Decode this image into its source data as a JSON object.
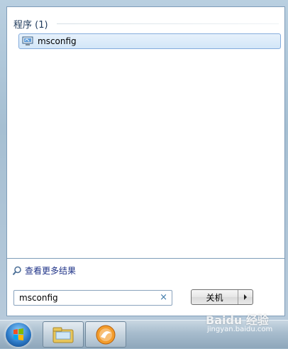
{
  "results": {
    "group_header": "程序 (1)",
    "items": [
      {
        "label": "msconfig",
        "icon": "msconfig-app-icon"
      }
    ]
  },
  "bottom": {
    "see_more": "查看更多结果",
    "search_value": "msconfig",
    "clear_glyph": "×",
    "shutdown_label": "关机"
  },
  "taskbar": {
    "buttons": [
      "start-orb",
      "explorer-icon",
      "browser-icon"
    ]
  },
  "watermark": {
    "brand": "Baidu 经验",
    "url": "jingyan.baidu.com"
  },
  "colors": {
    "accent": "#84acdd",
    "link": "#1e3287",
    "header": "#1e395b"
  }
}
